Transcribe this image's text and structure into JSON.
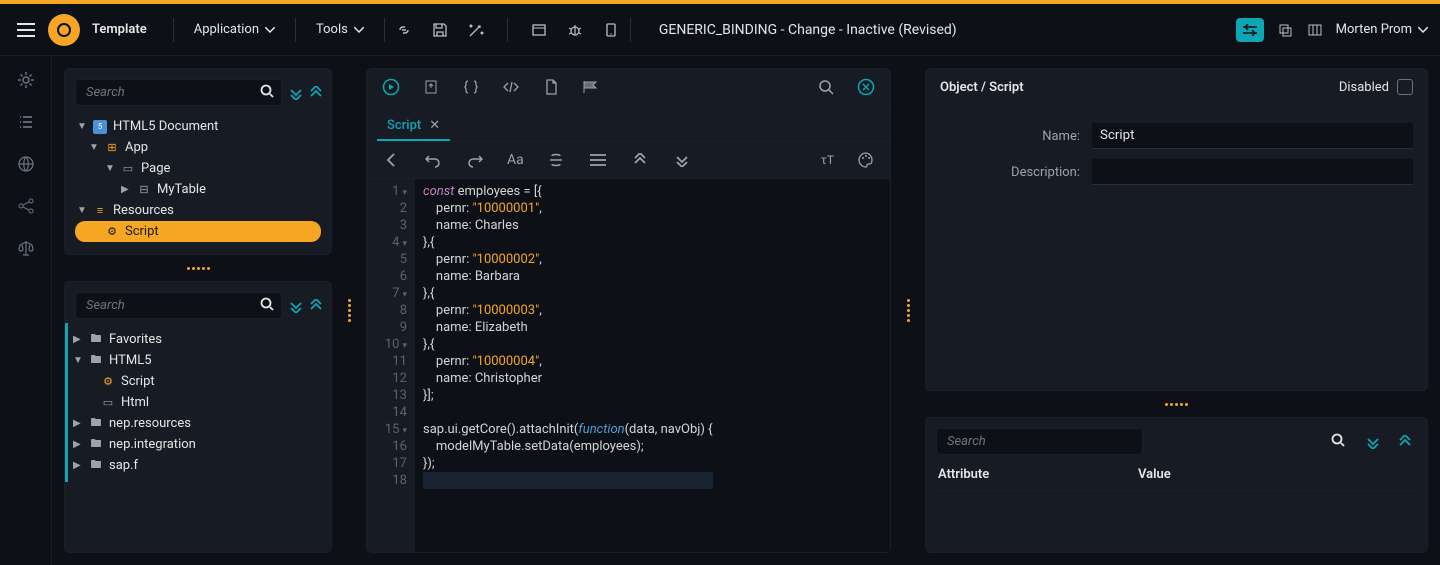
{
  "header": {
    "template": "Template",
    "application": "Application",
    "tools": "Tools",
    "title": "GENERIC_BINDING - Change - Inactive (Revised)",
    "user": "Morten Prom"
  },
  "left_panel": {
    "search_placeholder": "Search",
    "tree1": {
      "root": "HTML5 Document",
      "app": "App",
      "page": "Page",
      "mytable": "MyTable",
      "resources": "Resources",
      "script": "Script"
    },
    "tree2": {
      "favorites": "Favorites",
      "html5": "HTML5",
      "script": "Script",
      "html": "Html",
      "nep_resources": "nep.resources",
      "nep_integration": "nep.integration",
      "sap_f": "sap.f"
    }
  },
  "editor": {
    "tab": "Script",
    "code": [
      {
        "n": 1,
        "fold": true,
        "t": [
          {
            "c": "kw",
            "v": "const"
          },
          {
            "c": "id",
            "v": " employees = [{"
          }
        ]
      },
      {
        "n": 2,
        "t": [
          {
            "c": "id",
            "v": "    pernr: "
          },
          {
            "c": "str",
            "v": "\"10000001\""
          },
          {
            "c": "id",
            "v": ","
          }
        ]
      },
      {
        "n": 3,
        "t": [
          {
            "c": "id",
            "v": "    name: Charles"
          }
        ]
      },
      {
        "n": 4,
        "fold": true,
        "t": [
          {
            "c": "id",
            "v": "},{"
          }
        ]
      },
      {
        "n": 5,
        "t": [
          {
            "c": "id",
            "v": "    pernr: "
          },
          {
            "c": "str",
            "v": "\"10000002\""
          },
          {
            "c": "id",
            "v": ","
          }
        ]
      },
      {
        "n": 6,
        "t": [
          {
            "c": "id",
            "v": "    name: Barbara"
          }
        ]
      },
      {
        "n": 7,
        "fold": true,
        "t": [
          {
            "c": "id",
            "v": "},{"
          }
        ]
      },
      {
        "n": 8,
        "t": [
          {
            "c": "id",
            "v": "    pernr: "
          },
          {
            "c": "str",
            "v": "\"10000003\""
          },
          {
            "c": "id",
            "v": ","
          }
        ]
      },
      {
        "n": 9,
        "t": [
          {
            "c": "id",
            "v": "    name: Elizabeth"
          }
        ]
      },
      {
        "n": 10,
        "fold": true,
        "t": [
          {
            "c": "id",
            "v": "},{"
          }
        ]
      },
      {
        "n": 11,
        "t": [
          {
            "c": "id",
            "v": "    pernr: "
          },
          {
            "c": "str",
            "v": "\"10000004\""
          },
          {
            "c": "id",
            "v": ","
          }
        ]
      },
      {
        "n": 12,
        "t": [
          {
            "c": "id",
            "v": "    name: Christopher"
          }
        ]
      },
      {
        "n": 13,
        "t": [
          {
            "c": "id",
            "v": "}];"
          }
        ]
      },
      {
        "n": 14,
        "t": [
          {
            "c": "id",
            "v": ""
          }
        ]
      },
      {
        "n": 15,
        "fold": true,
        "t": [
          {
            "c": "id",
            "v": "sap.ui.getCore().attachInit("
          },
          {
            "c": "fn",
            "v": "function"
          },
          {
            "c": "id",
            "v": "(data, navObj) {"
          }
        ]
      },
      {
        "n": 16,
        "t": [
          {
            "c": "id",
            "v": "    modelMyTable.setData(employees);"
          }
        ]
      },
      {
        "n": 17,
        "t": [
          {
            "c": "id",
            "v": "});"
          }
        ]
      },
      {
        "n": 18,
        "hl": true,
        "t": [
          {
            "c": "id",
            "v": ""
          }
        ]
      }
    ]
  },
  "right_panel": {
    "title": "Object / Script",
    "disabled": "Disabled",
    "name_label": "Name:",
    "name_value": "Script",
    "description_label": "Description:",
    "attr_search_placeholder": "Search",
    "attr_col1": "Attribute",
    "attr_col2": "Value"
  }
}
